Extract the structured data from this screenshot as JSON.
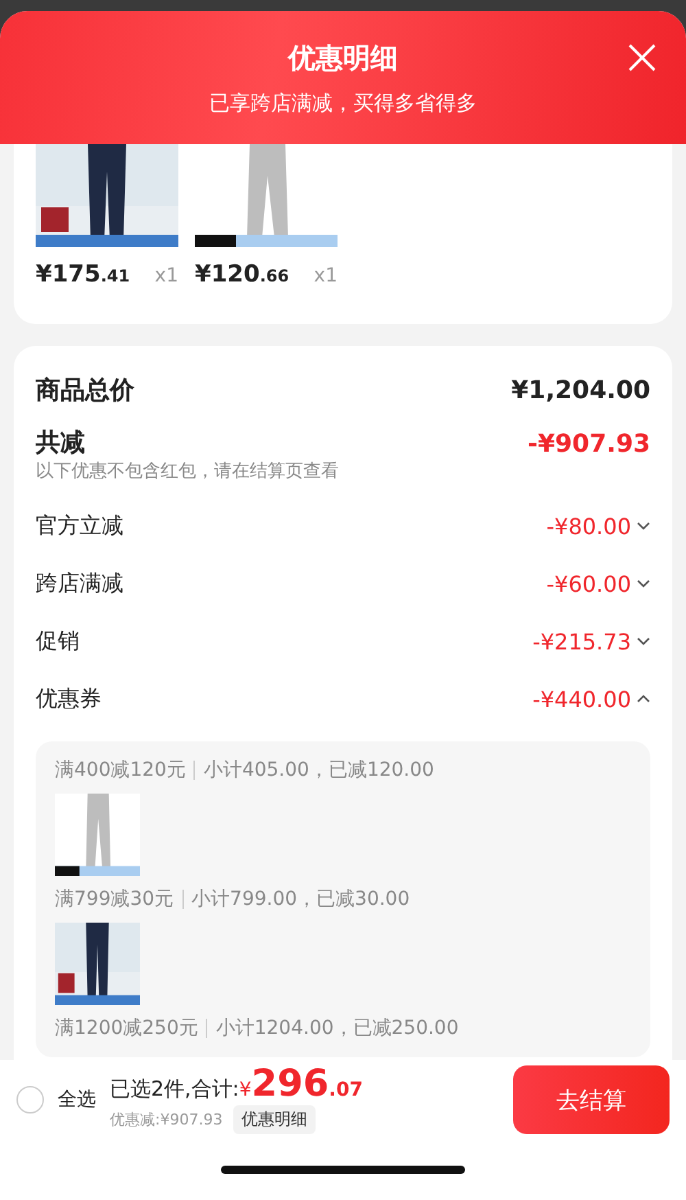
{
  "sheet": {
    "title": "优惠明细",
    "subtitle": "已享跨店满减，买得多省得多"
  },
  "products": [
    {
      "kind": "picture",
      "price_main": "¥175",
      "price_cents": ".41",
      "qty": "x1"
    },
    {
      "kind": "picture",
      "price_main": "¥120",
      "price_cents": ".66",
      "qty": "x1"
    }
  ],
  "summary": {
    "total_label": "商品总价",
    "total_value": "¥1,204.00",
    "discount_label": "共减",
    "discount_value": "-¥907.93",
    "note": "以下优惠不包含红包，请在结算页查看"
  },
  "discounts": [
    {
      "label": "官方立减",
      "value": "-¥80.00",
      "expanded": false
    },
    {
      "label": "跨店满减",
      "value": "-¥60.00",
      "expanded": false
    },
    {
      "label": "促销",
      "value": "-¥215.73",
      "expanded": false
    },
    {
      "label": "优惠券",
      "value": "-¥440.00",
      "expanded": true
    }
  ],
  "coupon_groups": [
    {
      "rule": "满400减120元",
      "detail": "小计405.00，已减120.00"
    },
    {
      "rule": "满799减30元",
      "detail": "小计799.00，已减30.00"
    },
    {
      "rule": "满1200减250元",
      "detail": "小计1204.00，已减250.00"
    }
  ],
  "footer": {
    "select_all": "全选",
    "checked": false,
    "selected_text": "已选2件,合计:",
    "currency": "¥",
    "total_main": "296",
    "total_cents": ".07",
    "saved": "优惠减:¥907.93",
    "detail_chip": "优惠明细",
    "checkout": "去结算"
  }
}
